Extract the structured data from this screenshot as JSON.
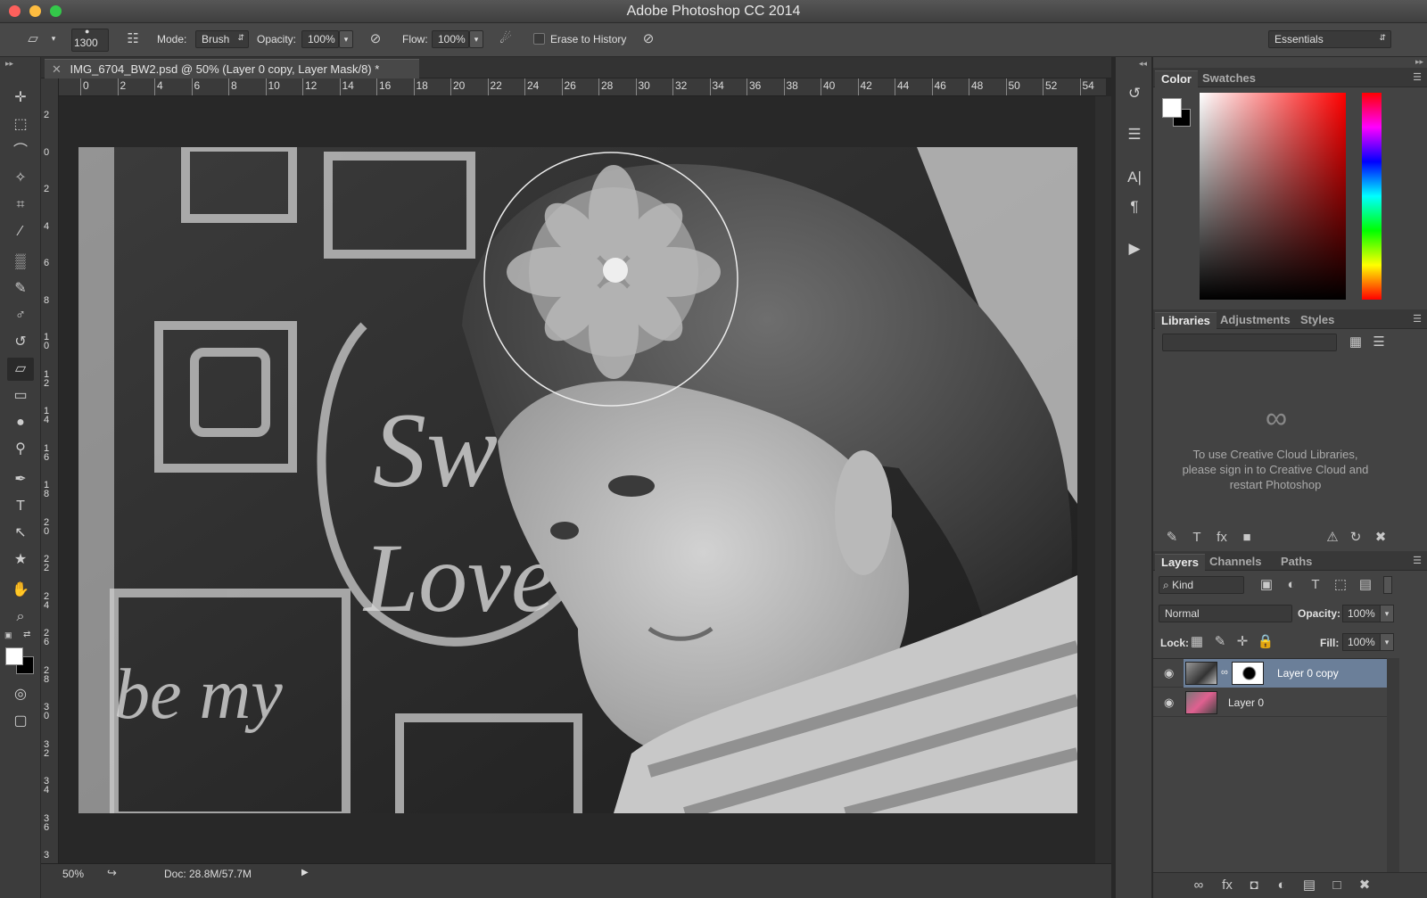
{
  "app": {
    "window_title": "Adobe Photoshop CC 2014"
  },
  "options_bar": {
    "brush_size": "1300",
    "mode_label": "Mode:",
    "mode_value": "Brush",
    "opacity_label": "Opacity:",
    "opacity_value": "100%",
    "flow_label": "Flow:",
    "flow_value": "100%",
    "erase_to_history_label": "Erase to History",
    "workspace": "Essentials"
  },
  "document": {
    "tab_title": "IMG_6704_BW2.psd @ 50% (Layer 0 copy, Layer Mask/8) *",
    "zoom": "50%",
    "doc_size": "Doc: 28.8M/57.7M"
  },
  "rulers": {
    "top": [
      "0",
      "2",
      "4",
      "6",
      "8",
      "10",
      "12",
      "14",
      "16",
      "18",
      "20",
      "22",
      "24",
      "26",
      "28",
      "30",
      "32",
      "34",
      "36",
      "38",
      "40",
      "42",
      "44",
      "46",
      "48",
      "50",
      "52",
      "54"
    ],
    "left": [
      "2",
      "0",
      "2",
      "4",
      "6",
      "8",
      "10",
      "12",
      "14",
      "16",
      "18",
      "20",
      "22",
      "24",
      "26",
      "28",
      "30",
      "32",
      "34",
      "36",
      "3"
    ]
  },
  "color_panel": {
    "tabs": [
      "Color",
      "Swatches"
    ],
    "foreground": "#ffffff",
    "background": "#000000"
  },
  "libraries_panel": {
    "tabs": [
      "Libraries",
      "Adjustments",
      "Styles"
    ],
    "message": "To use Creative Cloud Libraries, please sign in to Creative Cloud and restart Photoshop"
  },
  "layers_panel": {
    "tabs": [
      "Layers",
      "Channels",
      "Paths"
    ],
    "filter_kind": "Kind",
    "blend_mode": "Normal",
    "opacity_label": "Opacity:",
    "opacity_value": "100%",
    "lock_label": "Lock:",
    "fill_label": "Fill:",
    "fill_value": "100%",
    "layers": [
      {
        "name": "Layer 0 copy",
        "selected": true,
        "has_mask": true
      },
      {
        "name": "Layer 0",
        "selected": false,
        "has_mask": false
      }
    ]
  },
  "colors": {
    "selected_layer": "#6b7f99",
    "panel_bg": "#434343",
    "canvas_bg": "#282828"
  }
}
